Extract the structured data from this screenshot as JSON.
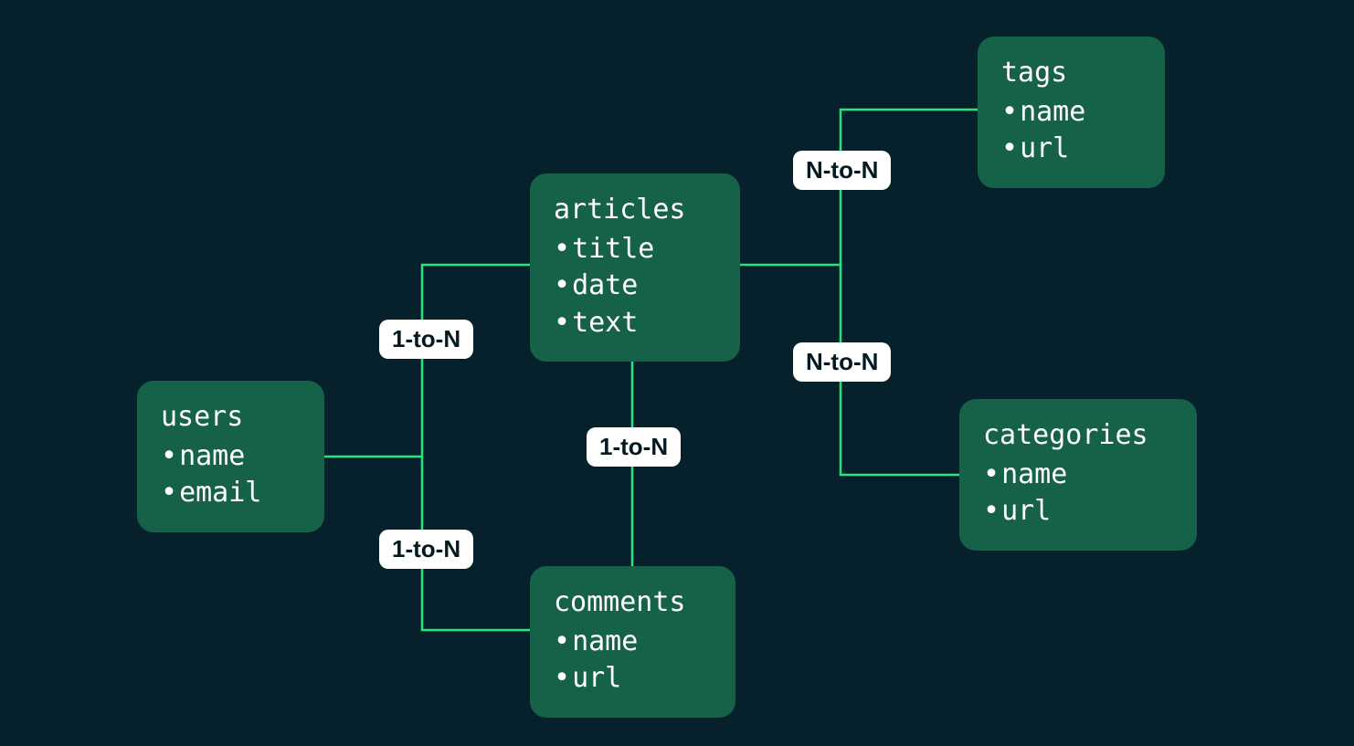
{
  "entities": {
    "users": {
      "title": "users",
      "fields": [
        "name",
        "email"
      ]
    },
    "articles": {
      "title": "articles",
      "fields": [
        "title",
        "date",
        "text"
      ]
    },
    "comments": {
      "title": "comments",
      "fields": [
        "name",
        "url"
      ]
    },
    "tags": {
      "title": "tags",
      "fields": [
        "name",
        "url"
      ]
    },
    "categories": {
      "title": "categories",
      "fields": [
        "name",
        "url"
      ]
    }
  },
  "relations": {
    "users_articles": "1-to-N",
    "users_comments": "1-to-N",
    "articles_comments": "1-to-N",
    "articles_tags": "N-to-N",
    "articles_categories": "N-to-N"
  },
  "colors": {
    "background": "#06202c",
    "node_fill": "#166249",
    "node_text": "#ffffff",
    "edge_stroke": "#23e77d",
    "label_bg": "#ffffff",
    "label_text": "#031a22"
  }
}
